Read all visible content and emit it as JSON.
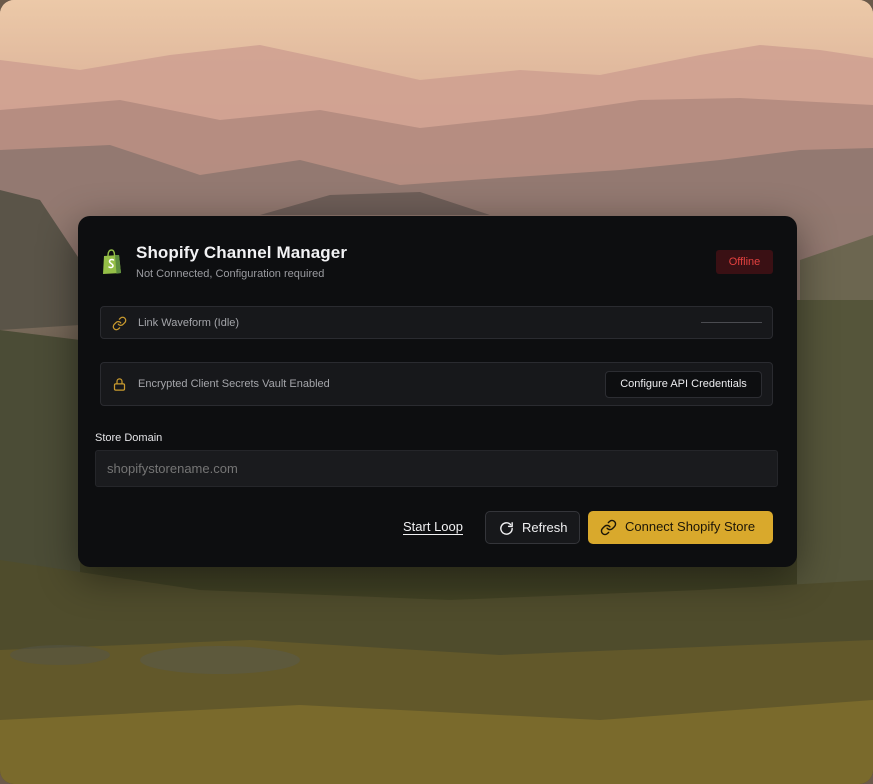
{
  "header": {
    "title": "Shopify Channel Manager",
    "subtitle": "Not Connected, Configuration required",
    "status_badge": "Offline"
  },
  "waveform": {
    "label": "Link Waveform (Idle)"
  },
  "vault": {
    "label": "Encrypted Client Secrets Vault Enabled",
    "configure_button": "Configure API Credentials"
  },
  "store_domain": {
    "label": "Store Domain",
    "placeholder": "shopifystorename.com"
  },
  "actions": {
    "start_loop": "Start Loop",
    "refresh": "Refresh",
    "connect": "Connect Shopify Store"
  },
  "icons": {
    "logo": "shopify-bag-icon",
    "waveform": "link-icon",
    "vault": "lock-icon",
    "refresh": "refresh-icon",
    "connect": "link-icon"
  },
  "colors": {
    "accent": "#d9a92c",
    "offline_text": "#e2413f",
    "offline_bg": "#3a1014",
    "card_bg": "#0d0e10"
  }
}
